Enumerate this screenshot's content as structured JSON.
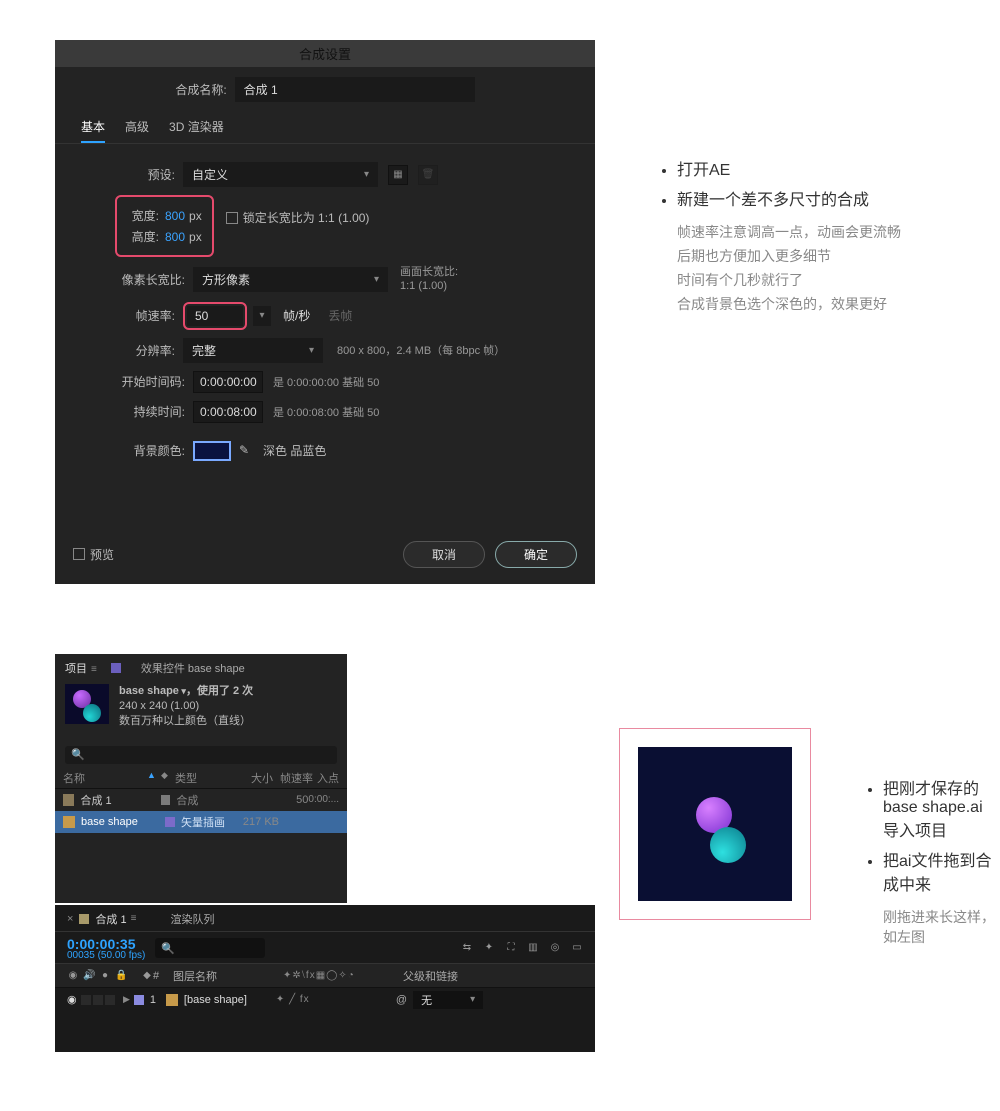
{
  "dialog": {
    "title": "合成设置",
    "comp_name_label": "合成名称:",
    "comp_name": "合成 1",
    "tabs": {
      "basic": "基本",
      "advanced": "高级",
      "renderer": "3D 渲染器"
    },
    "preset_label": "预设:",
    "preset": "自定义",
    "width_label": "宽度:",
    "width_value": "800",
    "height_label": "高度:",
    "height_value": "800",
    "px_unit": "px",
    "lock_ratio": "锁定长宽比为 1:1 (1.00)",
    "par_label": "像素长宽比:",
    "par_value": "方形像素",
    "par_note_l1": "画面长宽比:",
    "par_note_l2": "1:1 (1.00)",
    "fps_label": "帧速率:",
    "fps_value": "50",
    "fps_unit": "帧/秒",
    "drop_label": "丢帧",
    "res_label": "分辨率:",
    "res_value": "完整",
    "res_info": "800 x 800，2.4 MB（每 8bpc 帧）",
    "start_label": "开始时间码:",
    "start_value": "0:00:00:00",
    "start_info": "是 0:00:00:00 基础 50",
    "dur_label": "持续时间:",
    "dur_value": "0:00:08:00",
    "dur_info": "是 0:00:08:00 基础 50",
    "bg_label": "背景颜色:",
    "bg_name": "深色 品蓝色",
    "bg_hex": "#0a1240",
    "preview": "预览",
    "cancel": "取消",
    "ok": "确定"
  },
  "notes1": {
    "b1": "打开AE",
    "b2": "新建一个差不多尺寸的合成",
    "s1": "帧速率注意调高一点，动画会更流畅",
    "s2": "后期也方便加入更多细节",
    "s3": "时间有个几秒就行了",
    "s4": "合成背景色选个深色的，效果更好"
  },
  "project": {
    "tab1": "项目",
    "tab2": "效果控件 base shape",
    "asset_title": "base shape",
    "asset_used": "，使用了 2 次",
    "asset_dim": "240 x 240 (1.00)",
    "asset_colors": "数百万种以上颜色（直线）",
    "cols": {
      "name": "名称",
      "type": "类型",
      "size": "大小",
      "fps": "帧速率",
      "in": "入点"
    },
    "row1": {
      "name": "合成 1",
      "type": "合成",
      "fps": "50",
      "in": "0:00:..."
    },
    "row2": {
      "name": "base shape",
      "type": "矢量插画",
      "size": "217 KB"
    }
  },
  "timeline": {
    "tab_comp": "合成 1",
    "tab_render": "渲染队列",
    "timecode": "0:00:00:35",
    "frames": "00035 (50.00 fps)",
    "cols": {
      "hash": "#",
      "layer": "图层名称",
      "switches": "✦✲⧵fx▦◯✧◔",
      "parent": "父级和链接"
    },
    "layer": {
      "num": "1",
      "name": "[base shape]",
      "switches": "✦    ╱ fx",
      "parent": "无"
    }
  },
  "notes2": {
    "b1": "把刚才保存的 base shape.ai 导入项目",
    "b2": "把ai文件拖到合成中来",
    "s1": "刚拖进来长这样，如左图"
  }
}
